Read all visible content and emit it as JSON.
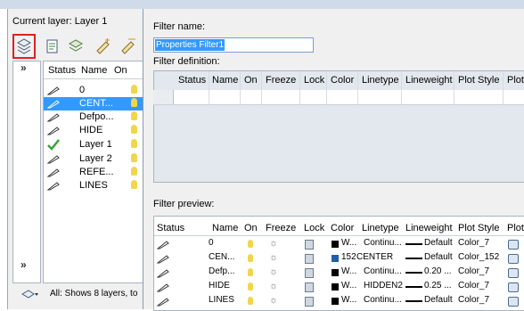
{
  "layer_manager": {
    "current_layer": "Current layer: Layer 1",
    "columns": [
      "Status",
      "Name",
      "On"
    ],
    "layers": [
      {
        "name": "0",
        "current": false,
        "selected": false
      },
      {
        "name": "CENT...",
        "current": false,
        "selected": true
      },
      {
        "name": "Defpo...",
        "current": false,
        "selected": false
      },
      {
        "name": "HIDE",
        "current": false,
        "selected": false
      },
      {
        "name": "Layer 1",
        "current": true,
        "selected": false
      },
      {
        "name": "Layer 2",
        "current": false,
        "selected": false
      },
      {
        "name": "REFE...",
        "current": false,
        "selected": false
      },
      {
        "name": "LINES",
        "current": false,
        "selected": false
      }
    ],
    "status_text": "All: Shows 8 layers, to",
    "expand_top": "»",
    "expand_bottom": "»"
  },
  "filter_dialog": {
    "filter_name_label": "Filter name:",
    "filter_name_value": "Properties Filter1",
    "filter_definition_label": "Filter definition:",
    "definition_columns": [
      "Status",
      "Name",
      "On",
      "Freeze",
      "Lock",
      "Color",
      "Linetype",
      "Lineweight",
      "Plot Style",
      "Plot"
    ],
    "filter_preview_label": "Filter preview:",
    "preview_columns": [
      "Status",
      "Name",
      "On",
      "Freeze",
      "Lock",
      "Color",
      "Linetype",
      "Lineweight",
      "Plot Style",
      "Plot"
    ],
    "preview_rows": [
      {
        "name": "0",
        "color_label": "W...",
        "color_hex": "#000000",
        "linetype": "Continu...",
        "lineweight": "Default",
        "plot_style": "Color_7"
      },
      {
        "name": "CEN...",
        "color_label": "152",
        "color_hex": "#1f5fa8",
        "linetype": "CENTER",
        "lineweight": "Default",
        "plot_style": "Color_152"
      },
      {
        "name": "Defp...",
        "color_label": "W...",
        "color_hex": "#000000",
        "linetype": "Continu...",
        "lineweight": "0.20 ...",
        "plot_style": "Color_7"
      },
      {
        "name": "HIDE",
        "color_label": "W...",
        "color_hex": "#000000",
        "linetype": "HIDDEN2",
        "lineweight": "0.25 ...",
        "plot_style": "Color_7"
      },
      {
        "name": "LINES",
        "color_label": "W...",
        "color_hex": "#000000",
        "linetype": "Continu...",
        "lineweight": "Default",
        "plot_style": "Color_7"
      }
    ]
  },
  "colors": {
    "selection": "#3399ff",
    "highlight_box": "#e02020",
    "window_bg": "#f0f0f0"
  }
}
